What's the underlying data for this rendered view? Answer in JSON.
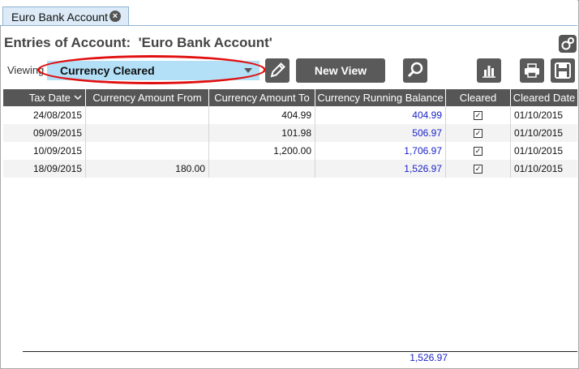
{
  "tab": {
    "label": "Euro Bank Account",
    "close_glyph": "×"
  },
  "title": "Entries of Account:  'Euro Bank Account'",
  "viewing_label": "Viewing",
  "view_select": {
    "value": "Currency Cleared"
  },
  "toolbar": {
    "new_view_label": "New View"
  },
  "columns": [
    "Tax Date",
    "Currency Amount From",
    "Currency Amount To",
    "Currency Running Balance",
    "Cleared",
    "Cleared Date"
  ],
  "rows": [
    {
      "tax_date": "24/08/2015",
      "amount_from": "",
      "amount_to": "404.99",
      "balance": "404.99",
      "cleared": true,
      "cleared_date": "01/10/2015"
    },
    {
      "tax_date": "09/09/2015",
      "amount_from": "",
      "amount_to": "101.98",
      "balance": "506.97",
      "cleared": true,
      "cleared_date": "01/10/2015"
    },
    {
      "tax_date": "10/09/2015",
      "amount_from": "",
      "amount_to": "1,200.00",
      "balance": "1,706.97",
      "cleared": true,
      "cleared_date": "01/10/2015"
    },
    {
      "tax_date": "18/09/2015",
      "amount_from": "180.00",
      "amount_to": "",
      "balance": "1,526.97",
      "cleared": true,
      "cleared_date": "01/10/2015"
    }
  ],
  "footer_total": "1,526.97",
  "colors": {
    "accent_select": "#b3e0f7",
    "header_bg": "#565656",
    "balance_text": "#1a22c8",
    "highlight_ring": "#e01010"
  },
  "icons": [
    "close-icon",
    "settings-icon",
    "pencil-icon",
    "search-icon",
    "chart-icon",
    "print-icon",
    "save-icon",
    "sort-down-icon"
  ]
}
